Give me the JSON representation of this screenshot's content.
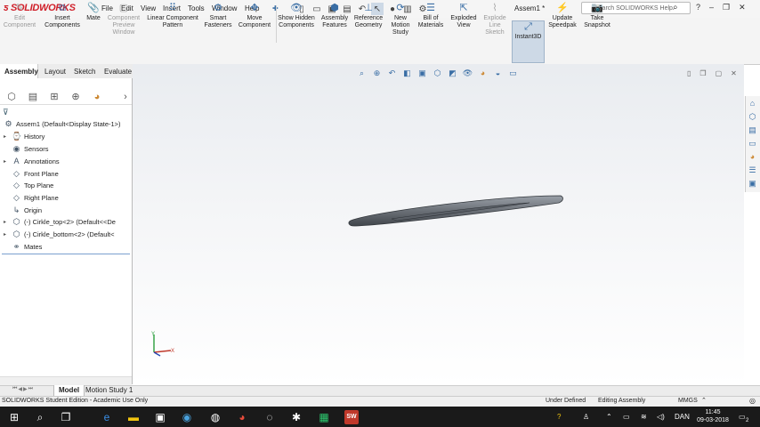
{
  "app": {
    "logo": "SOLIDWORKS",
    "document_title": "Assem1 *"
  },
  "menu": [
    "File",
    "Edit",
    "View",
    "Insert",
    "Tools",
    "Window",
    "Help"
  ],
  "search": {
    "placeholder": "Search SOLIDWORKS Help"
  },
  "toolbar": {
    "edit_component": "Edit Component",
    "insert_components": "Insert Components",
    "mate": "Mate",
    "component_preview": "Component Preview Window",
    "linear_pattern": "Linear Component Pattern",
    "smart_fasteners": "Smart Fasteners",
    "move_component": "Move Component",
    "show_hidden": "Show Hidden Components",
    "assembly_features": "Assembly Features",
    "reference_geometry": "Reference Geometry",
    "new_motion_study": "New Motion Study",
    "bom": "Bill of Materials",
    "exploded_view": "Exploded View",
    "explode_line": "Explode Line Sketch",
    "instant3d": "Instant3D",
    "update_speedpak": "Update Speedpak",
    "take_snapshot": "Take Snapshot"
  },
  "tabs": [
    "Assembly",
    "Layout",
    "Sketch",
    "Evaluate"
  ],
  "tree": {
    "root": "Assem1  (Default<Display State-1>)",
    "history": "History",
    "sensors": "Sensors",
    "annotations": "Annotations",
    "front_plane": "Front Plane",
    "top_plane": "Top Plane",
    "right_plane": "Right Plane",
    "origin": "Origin",
    "part1": "(-) Cirkle_top<2> (Default<<De",
    "part2": "(-) Cirkle_bottom<2> (Default<",
    "mates": "Mates"
  },
  "bottom_tabs": {
    "model": "Model",
    "motion": "Motion Study 1"
  },
  "status": {
    "edition": "SOLIDWORKS Student Edition - Academic Use Only",
    "definition": "Under Defined",
    "mode": "Editing Assembly",
    "units": "MMGS"
  },
  "taskbar": {
    "lang": "DAN",
    "time": "11:45",
    "date": "09-03-2018",
    "notifications": "2"
  },
  "triad": {
    "y": "Y",
    "x": "X"
  }
}
